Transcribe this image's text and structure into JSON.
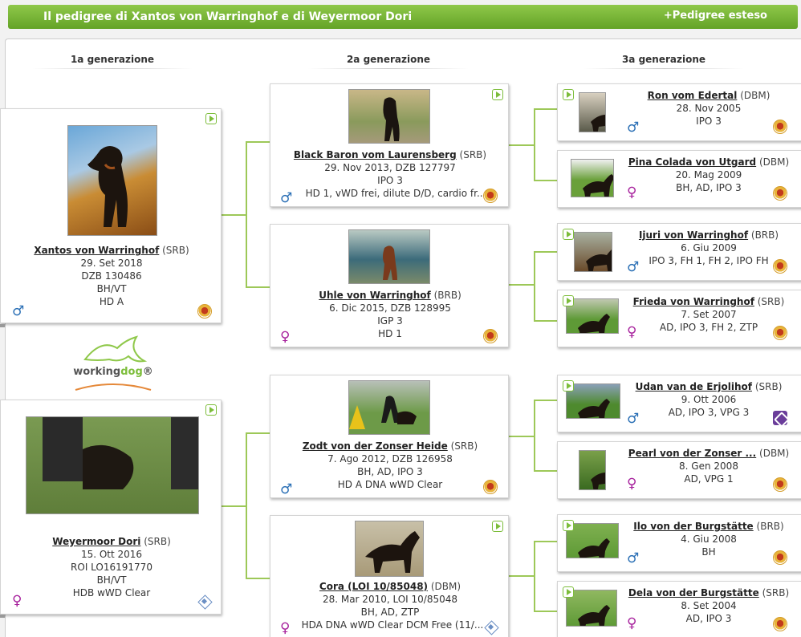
{
  "header": {
    "title": "Il pedigree di Xantos von Warringhof e di Weyermoor Dori",
    "extended_link": "+Pedigree esteso"
  },
  "generations": [
    "1a generazione",
    "2a generazione",
    "3a generazione"
  ],
  "logo": {
    "text_left": "working",
    "text_right": "dog",
    "mark": "®"
  },
  "symbols": {
    "male": "♂",
    "female": "♀"
  },
  "gen1": [
    {
      "name": "Xantos von Warringhof",
      "reg": "(SRB)",
      "lines": [
        "29. Set 2018",
        "DZB 130486",
        "BH/VT",
        "HD A"
      ],
      "sex": "male",
      "club": "club-red"
    },
    {
      "name": "Weyermoor Dori",
      "reg": "(SRB)",
      "lines": [
        "15. Ott 2016",
        "ROI LO16191770",
        "BH/VT",
        "HDB wWD Clear"
      ],
      "sex": "female",
      "club": "club-blue"
    }
  ],
  "gen2": [
    {
      "name": "Black Baron vom Laurensberg",
      "reg": "(SRB)",
      "lines": [
        "29. Nov 2013, DZB 127797",
        "IPO 3",
        "HD 1, vWD frei, dilute D/D, cardio fr..."
      ],
      "sex": "male",
      "club": "club-red"
    },
    {
      "name": "Uhle von Warringhof",
      "reg": "(BRB)",
      "lines": [
        "6. Dic 2015, DZB 128995",
        "IGP 3",
        "HD 1"
      ],
      "sex": "female",
      "club": "club-red"
    },
    {
      "name": "Zodt von der Zonser Heide",
      "reg": "(SRB)",
      "lines": [
        "7. Ago 2012, DZB 126958",
        "BH, AD, IPO 3",
        "HD A DNA wWD Clear"
      ],
      "sex": "male",
      "club": "club-red"
    },
    {
      "name": "Cora (LOI 10/85048)",
      "reg": "(DBM)",
      "lines": [
        "28. Mar 2010, LOI 10/85048",
        "BH, AD, ZTP",
        "HDA DNA wWD Clear DCM Free (11/..."
      ],
      "sex": "female",
      "club": "club-blue"
    }
  ],
  "gen3": [
    {
      "name": "Ron vom Edertal",
      "reg": "(DBM)",
      "lines": [
        "28. Nov 2005",
        "IPO 3"
      ],
      "sex": "male",
      "club": "club-red",
      "video": true
    },
    {
      "name": "Pina Colada von Utgard",
      "reg": "(DBM)",
      "lines": [
        "20. Mag 2009",
        "BH, AD, IPO 3"
      ],
      "sex": "female",
      "club": "club-red",
      "video": false
    },
    {
      "name": "Ijuri von Warringhof",
      "reg": "(BRB)",
      "lines": [
        "6. Giu 2009",
        "IPO 3, FH 1, FH 2, IPO FH"
      ],
      "sex": "male",
      "club": "club-red",
      "video": true
    },
    {
      "name": "Frieda von Warringhof",
      "reg": "(SRB)",
      "lines": [
        "7. Set 2007",
        "AD, IPO 3, FH 2, ZTP"
      ],
      "sex": "female",
      "club": "club-red",
      "video": true
    },
    {
      "name": "Udan van de Erjolihof",
      "reg": "(SRB)",
      "lines": [
        "9. Ott 2006",
        "AD, IPO 3, VPG 3"
      ],
      "sex": "male",
      "club": "club-purple",
      "video": true
    },
    {
      "name": "Pearl von der Zonser ...",
      "reg": "(DBM)",
      "lines": [
        "8. Gen 2008",
        "AD, VPG 1"
      ],
      "sex": "female",
      "club": "club-red",
      "video": false
    },
    {
      "name": "Ilo von der Burgstätte",
      "reg": "(BRB)",
      "lines": [
        "4. Giu 2008",
        "BH"
      ],
      "sex": "male",
      "club": "club-red",
      "video": true
    },
    {
      "name": "Dela von der Burgstätte",
      "reg": "(SRB)",
      "lines": [
        "8. Set 2004",
        "AD, IPO 3"
      ],
      "sex": "female",
      "club": "club-red",
      "video": true
    }
  ]
}
